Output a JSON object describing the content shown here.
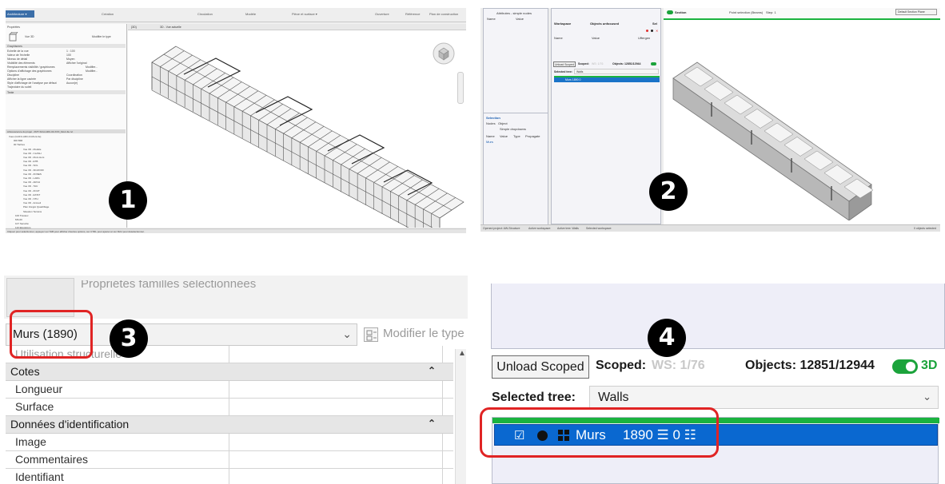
{
  "panel1": {
    "ribbon_button": "Architecture ▾",
    "ribbon_tabs": [
      "Création",
      "Circulation",
      "Modèle",
      "Pièce et surface ▾",
      "Ouverture",
      "Référence",
      "Plan de construction"
    ],
    "properties_title": "Propriétés",
    "type_name": "Vue 3D",
    "edit_type": "Modifier le type",
    "graphics_header": "Graphismes",
    "prop_rows": [
      "Echelle de la vue",
      "Valeur de l'échelle",
      "Niveau de détail",
      "Visibilité des éléments",
      "Remplacements visibilité / graphismes",
      "Options d'affichage des graphismes",
      "Discipline",
      "Afficher la ligne cachée",
      "Style d'affichage de l'analyse par défaut",
      "Trajectoire du soleil"
    ],
    "prop_values": [
      "1 : 100",
      "100",
      "Moyen",
      "Afficher l'original",
      "Modifier...",
      "Modifier...",
      "Coordination",
      "Par discipline",
      "Aucun(e)",
      ""
    ],
    "extents_header": "Texte",
    "browser_title": "Arborescence du projet - RVT-SCH-ARC-00-XXX_Mont-Ile.rvt",
    "browser_items": [
      "Vues (GUFU-ARC-D-Mont-Ile)",
      "000 BIM",
      "00 Tâches",
      "Vue 3D - Modèle",
      "Vue 3D - CLASH",
      "Vue 3D - Murs Hors",
      "Vue 3D - ETB",
      "Vue 3D - SOL",
      "Vue 3D - 3D-ROOF",
      "Vue 3D - ZONES",
      "Vue 3D - LARG",
      "Vue 3D - ARCH",
      "Vue 3D - TAU",
      "Vue 3D - ZOUT",
      "Vue 3D - EXIST",
      "Vue 3D - NTH",
      "Vue 3D - Accueil",
      "Plan Intégré Quadrillage",
      "Situation Terrains",
      "100 Travaux",
      "MS-00",
      "107 Sécurité",
      "110 Elévations"
    ],
    "view_tabs": [
      "{3D}",
      "3D - Vue actuelle"
    ],
    "status_text": "Cliquez pour sélectionner, appuyez sur TAB pour afficher d'autres options, sur CTRL pour ajouter et sur MAJ pour désélectionner.",
    "badge": "1"
  },
  "panel2": {
    "attr_title": "Attributes - simple nodes",
    "attr_cols": [
      "Name",
      "Value"
    ],
    "workspace_label": "Workspace",
    "objects_unfocused": "Objects unfocused",
    "sel_label": "Sel",
    "col_headers": [
      "Name",
      "Value",
      "Uffergen"
    ],
    "unload_scoped": "Unload Scoped",
    "scoped": "Scoped:",
    "ws_value": "WS: 1/76",
    "objects": "Objects: 12851/12944",
    "toggle_3d": "3D",
    "selected_tree": "Selected tree:",
    "tree_value": "Walls",
    "row_text": "Murs  1890 0",
    "section_label": "Section",
    "point_sel": "Point selection (Beams)",
    "step": "Step: 1",
    "default_section": "Default Section Plane",
    "selection_title": "Selection",
    "sel_tabs": [
      "Nodes",
      "Object"
    ],
    "sel_simple": "Simple dropdowns",
    "sel_cols": [
      "Name",
      "Value",
      "Type",
      "Propagate"
    ],
    "sel_row": "Murs",
    "status_items": [
      "Opened project: AW-Structure",
      "Active workspace:",
      "Active tree: Walls",
      "Selected workspace:"
    ],
    "status_right": "0 objects selected",
    "badge": "2"
  },
  "panel3": {
    "cut_text": "Propriétés familles sélectionnées",
    "dropdown_value": "Murs (1890)",
    "modify_type": "Modifier le type",
    "rows": [
      {
        "kind": "row",
        "label": "Utilisation structurelle"
      },
      {
        "kind": "group",
        "label": "Cotes"
      },
      {
        "kind": "row",
        "label": "Longueur"
      },
      {
        "kind": "row",
        "label": "Surface"
      },
      {
        "kind": "group",
        "label": "Données d'identification"
      },
      {
        "kind": "row",
        "label": "Image"
      },
      {
        "kind": "row",
        "label": "Commentaires"
      },
      {
        "kind": "row",
        "label": "Identifiant"
      }
    ],
    "badge": "3"
  },
  "panel4": {
    "unload_scoped": "Unload Scoped",
    "scoped": "Scoped:",
    "ws_value": "WS: 1/76",
    "objects": "Objects: 12851/12944",
    "toggle_3d": "3D",
    "selected_tree": "Selected tree:",
    "tree_value": "Walls",
    "row_name": "Murs",
    "row_counts": "1890 ☰ 0 ☷",
    "badge": "4"
  },
  "colors": {
    "highlight_red": "#e02424",
    "selection_blue": "#0a68d0",
    "toggle_green": "#1ba33b"
  }
}
